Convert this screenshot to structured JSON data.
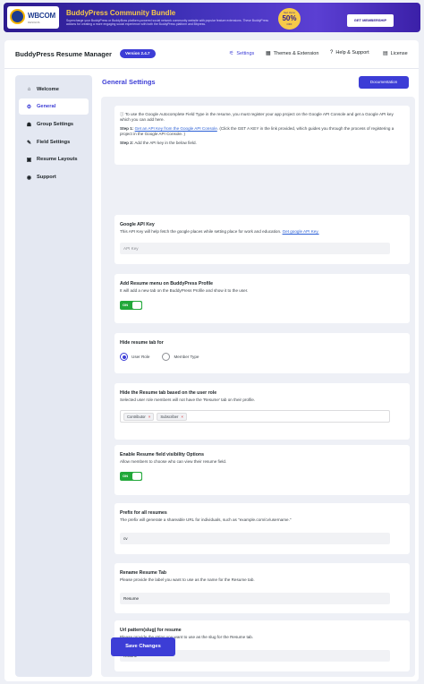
{
  "banner": {
    "logo_text": "WBCOM",
    "logo_sub": "DESIGNS",
    "title": "BuddyPress Community Bundle",
    "desc": "Supercharge your BuddyPress or BuddyBoss platform-powered social network community website with popular feature extensions. These BuddyPress addons for creating a more engaging social experience with both the BuddyPress platform and Bbpress.",
    "sale_top": "Get Up to",
    "sale_pct": "50%",
    "sale_bottom": "OFF",
    "cta": "GET MEMBERSHIP"
  },
  "header": {
    "title": "BuddyPress Resume Manager",
    "version": "Version 2.4.7",
    "nav": [
      {
        "label": "Settings",
        "icon": "sliders-icon",
        "active": true
      },
      {
        "label": "Themes & Extension",
        "icon": "grid-icon",
        "active": false
      },
      {
        "label": "Help & Support",
        "icon": "help-icon",
        "active": false
      },
      {
        "label": "License",
        "icon": "license-icon",
        "active": false
      }
    ]
  },
  "sidebar": {
    "items": [
      {
        "label": "Welcome",
        "icon": "home-icon"
      },
      {
        "label": "General",
        "icon": "gear-icon"
      },
      {
        "label": "Group Settings",
        "icon": "group-icon"
      },
      {
        "label": "Field Settings",
        "icon": "wrench-icon"
      },
      {
        "label": "Resume Layouts",
        "icon": "layout-icon"
      },
      {
        "label": "Support",
        "icon": "support-icon"
      }
    ],
    "active": "General"
  },
  "main": {
    "title": "General Settings",
    "doc_button": "Documentation",
    "intro": {
      "line1": "To use the Google Autocomplete Field Type in the resume, you must register your app project on the Google API Console and get a Google API key which you can add here.",
      "step1_prefix": "Step 1:",
      "step1_link": "Get an API Key from the Google API Console",
      "step1_rest": ". (Click the GET A KEY in the link provided, which guides you through the process of registering a project in the Google API Console. )",
      "step2_prefix": "Step 2:",
      "step2_rest": "Add the API key in the below field."
    },
    "api_key": {
      "label": "Google API Key",
      "desc": "This API Key will help fetch the google places while setting place for work and education.",
      "link": "Get google API Key.",
      "placeholder": "API Key"
    },
    "add_menu": {
      "label": "Add Resume menu on BuddyPress Profile",
      "desc": "It will add a new tab on the BuddyPress Profile and show it to the user.",
      "toggle": "ON"
    },
    "hide_tab_for": {
      "label": "Hide resume tab for",
      "options": [
        "User Role",
        "Member Type"
      ],
      "selected": "User Role"
    },
    "hide_by_role": {
      "label": "Hide the Resume tab based on the user role",
      "desc": "Selected user role members will not have the 'Resume' tab on their profile.",
      "roles": [
        "Contributor",
        "Subscriber"
      ],
      "remove_glyph": "×"
    },
    "visibility": {
      "label": "Enable Resume field visibility Options",
      "desc": "Allow members to choose who can view their resume field.",
      "toggle": "ON"
    },
    "prefix": {
      "label": "Prefix for all resumes",
      "desc": "The prefix will generate a shareable URL for individuals, such as \"example.com/cv/username.\"",
      "value": "cv"
    },
    "rename": {
      "label": "Rename Resume Tab",
      "desc": "Please provide the label you want to use as the name for the Resume tab.",
      "value": "Resume"
    },
    "slug": {
      "label": "Url pattern(slug) for resume",
      "desc": "Please provide the string you want to use as the slug for the Resume tab.",
      "value": "resume"
    },
    "save_button": "Save Changes"
  },
  "colors": {
    "accent": "#3c3dd6",
    "toggle_on": "#22a83a",
    "banner_title": "#f7c948"
  }
}
